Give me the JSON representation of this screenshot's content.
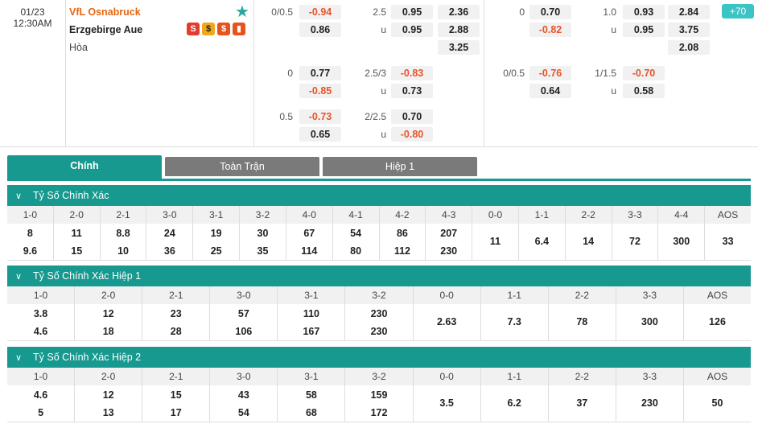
{
  "match": {
    "date": "01/23",
    "time": "12:30AM",
    "home": "VfL Osnabruck",
    "away": "Erzgebirge Aue",
    "draw": "Hòa",
    "icons": [
      "S",
      "$",
      "$",
      "chart"
    ],
    "more_badge": "+70"
  },
  "odds_ft": {
    "ah": [
      {
        "line": "0/0.5",
        "home": "-0.94",
        "away": "0.86"
      },
      {
        "line": "0",
        "home": "0.77",
        "away": "-0.85"
      },
      {
        "line": "0.5",
        "home": "-0.73",
        "away": "0.65"
      }
    ],
    "ou": [
      {
        "line": "2.5",
        "under_label": "u",
        "over": "0.95",
        "under": "0.95"
      },
      {
        "line": "2.5/3",
        "under_label": "u",
        "over": "-0.83",
        "under": "0.73"
      },
      {
        "line": "2/2.5",
        "under_label": "u",
        "over": "0.70",
        "under": "-0.80"
      }
    ],
    "x12": [
      "2.36",
      "2.88",
      "3.25"
    ]
  },
  "odds_ht": {
    "ah": [
      {
        "line": "0",
        "home": "0.70",
        "away": "-0.82"
      },
      {
        "line": "0/0.5",
        "home": "-0.76",
        "away": "0.64"
      }
    ],
    "ou": [
      {
        "line": "1.0",
        "under_label": "u",
        "over": "0.93",
        "under": "0.95"
      },
      {
        "line": "1/1.5",
        "under_label": "u",
        "over": "-0.70",
        "under": "0.58"
      }
    ],
    "x12": [
      "2.84",
      "3.75",
      "2.08"
    ]
  },
  "tabs": [
    "Chính",
    "Toàn Trận",
    "Hiệp 1"
  ],
  "sections": [
    {
      "title": "Tỷ Số Chính Xác",
      "headers": [
        "1-0",
        "2-0",
        "2-1",
        "3-0",
        "3-1",
        "3-2",
        "4-0",
        "4-1",
        "4-2",
        "4-3",
        "0-0",
        "1-1",
        "2-2",
        "3-3",
        "4-4",
        "AOS"
      ],
      "top": [
        "8",
        "11",
        "8.8",
        "24",
        "19",
        "30",
        "67",
        "54",
        "86",
        "207",
        "",
        "",
        "",
        "",
        "",
        ""
      ],
      "bottom": [
        "9.6",
        "15",
        "10",
        "36",
        "25",
        "35",
        "114",
        "80",
        "112",
        "230",
        "",
        "",
        "",
        "",
        "",
        ""
      ],
      "mid": [
        "",
        "",
        "",
        "",
        "",
        "",
        "",
        "",
        "",
        "",
        "11",
        "6.4",
        "14",
        "72",
        "300",
        "33"
      ]
    },
    {
      "title": "Tỷ Số Chính Xác Hiệp 1",
      "headers": [
        "1-0",
        "2-0",
        "2-1",
        "3-0",
        "3-1",
        "3-2",
        "0-0",
        "1-1",
        "2-2",
        "3-3",
        "AOS"
      ],
      "top": [
        "3.8",
        "12",
        "23",
        "57",
        "110",
        "230",
        "",
        "",
        "",
        "",
        ""
      ],
      "bottom": [
        "4.6",
        "18",
        "28",
        "106",
        "167",
        "230",
        "",
        "",
        "",
        "",
        ""
      ],
      "mid": [
        "",
        "",
        "",
        "",
        "",
        "",
        "2.63",
        "7.3",
        "78",
        "300",
        "126"
      ]
    },
    {
      "title": "Tỷ Số Chính Xác Hiệp 2",
      "headers": [
        "1-0",
        "2-0",
        "2-1",
        "3-0",
        "3-1",
        "3-2",
        "0-0",
        "1-1",
        "2-2",
        "3-3",
        "AOS"
      ],
      "top": [
        "4.6",
        "12",
        "15",
        "43",
        "58",
        "159",
        "",
        "",
        "",
        "",
        ""
      ],
      "bottom": [
        "5",
        "13",
        "17",
        "54",
        "68",
        "172",
        "",
        "",
        "",
        "",
        ""
      ],
      "mid": [
        "",
        "",
        "",
        "",
        "",
        "",
        "3.5",
        "6.2",
        "37",
        "230",
        "50"
      ]
    }
  ],
  "colors": {
    "accent": "#17998f",
    "home": "#e8660f",
    "negative": "#e8532a",
    "star": "#27a7a0"
  }
}
